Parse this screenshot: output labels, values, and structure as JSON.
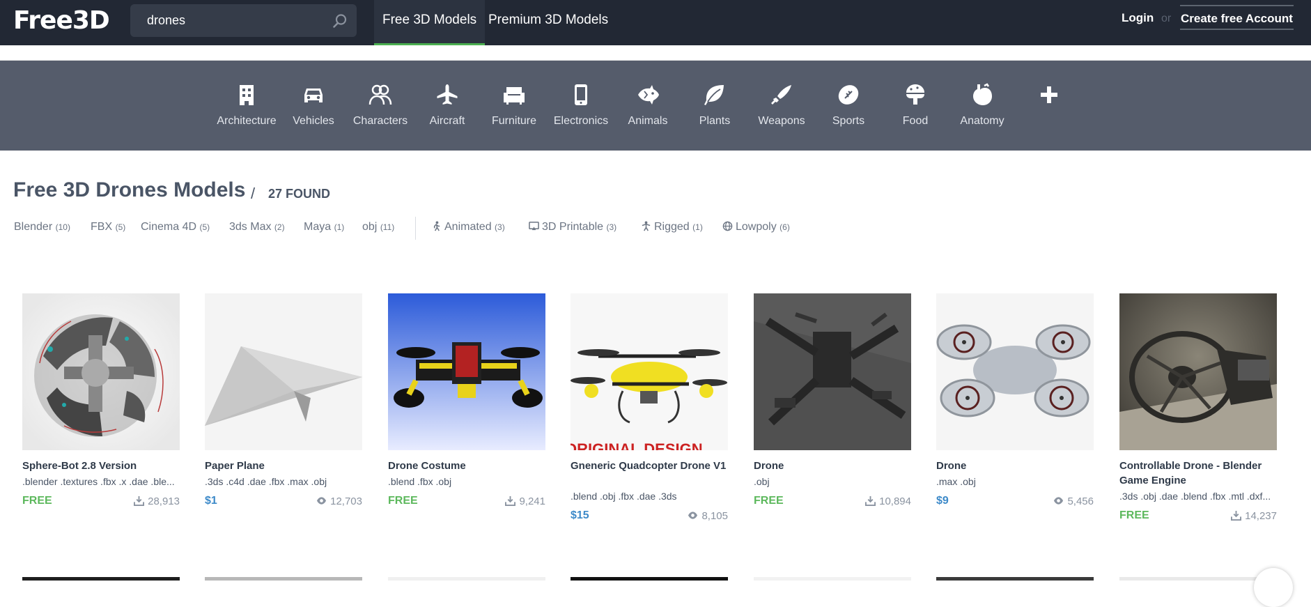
{
  "header": {
    "logo": "Free3D",
    "search_value": "drones",
    "tabs": [
      "Free 3D Models",
      "Premium 3D Models"
    ],
    "login": "Login",
    "or": "or",
    "create_account": "Create free Account"
  },
  "categories": [
    {
      "label": "Architecture",
      "icon": "building-icon"
    },
    {
      "label": "Vehicles",
      "icon": "car-icon"
    },
    {
      "label": "Characters",
      "icon": "people-icon"
    },
    {
      "label": "Aircraft",
      "icon": "plane-icon"
    },
    {
      "label": "Furniture",
      "icon": "sofa-icon"
    },
    {
      "label": "Electronics",
      "icon": "phone-icon"
    },
    {
      "label": "Animals",
      "icon": "fish-icon"
    },
    {
      "label": "Plants",
      "icon": "leaf-icon"
    },
    {
      "label": "Weapons",
      "icon": "knife-icon"
    },
    {
      "label": "Sports",
      "icon": "football-icon"
    },
    {
      "label": "Food",
      "icon": "food-icon"
    },
    {
      "label": "Anatomy",
      "icon": "anatomy-icon"
    },
    {
      "label": "",
      "icon": "plus-icon"
    }
  ],
  "page": {
    "title": "Free 3D Drones Models",
    "slash": "/",
    "found": "27 FOUND"
  },
  "filters": {
    "formats": [
      {
        "label": "Blender",
        "count": "(10)"
      },
      {
        "label": "FBX",
        "count": "(5)"
      },
      {
        "label": "Cinema 4D",
        "count": "(5)"
      },
      {
        "label": "3ds Max",
        "count": "(2)"
      },
      {
        "label": "Maya",
        "count": "(1)"
      },
      {
        "label": "obj",
        "count": "(11)"
      }
    ],
    "attributes": [
      {
        "label": "Animated",
        "count": "(3)",
        "icon": "walking-icon"
      },
      {
        "label": "3D Printable",
        "count": "(3)",
        "icon": "printer-icon"
      },
      {
        "label": "Rigged",
        "count": "(1)",
        "icon": "rig-icon"
      },
      {
        "label": "Lowpoly",
        "count": "(6)",
        "icon": "globe-icon"
      }
    ]
  },
  "models": [
    {
      "name": "Sphere-Bot 2.8 Version",
      "formats": ".blender .textures .fbx .x .dae .ble...",
      "price": "FREE",
      "stat": "28,913",
      "stat_icon": "download-icon"
    },
    {
      "name": "Paper Plane",
      "formats": ".3ds .c4d .dae .fbx .max .obj",
      "price": "$1",
      "stat": "12,703",
      "stat_icon": "eye-icon"
    },
    {
      "name": "Drone Costume",
      "formats": ".blend .fbx .obj",
      "price": "FREE",
      "stat": "9,241",
      "stat_icon": "download-icon"
    },
    {
      "name": "Gneneric Quadcopter Drone V1",
      "formats": ".blend .obj .fbx .dae .3ds",
      "price": "$15",
      "stat": "8,105",
      "stat_icon": "eye-icon",
      "thumb_text": "ORIGINAL DESIGN"
    },
    {
      "name": "Drone",
      "formats": ".obj",
      "price": "FREE",
      "stat": "10,894",
      "stat_icon": "download-icon"
    },
    {
      "name": "Drone",
      "formats": ".max .obj",
      "price": "$9",
      "stat": "5,456",
      "stat_icon": "eye-icon"
    },
    {
      "name": "Controllable Drone - Blender Game Engine",
      "formats": ".3ds .obj .dae .blend .fbx .mtl .dxf...",
      "price": "FREE",
      "stat": "14,237",
      "stat_icon": "download-icon"
    }
  ],
  "colors": {
    "header_bg": "#222834",
    "category_bg": "#555c6b",
    "free": "#5cb85c",
    "paid": "#3d8ac9",
    "active_tab_underline": "#4caf50"
  }
}
